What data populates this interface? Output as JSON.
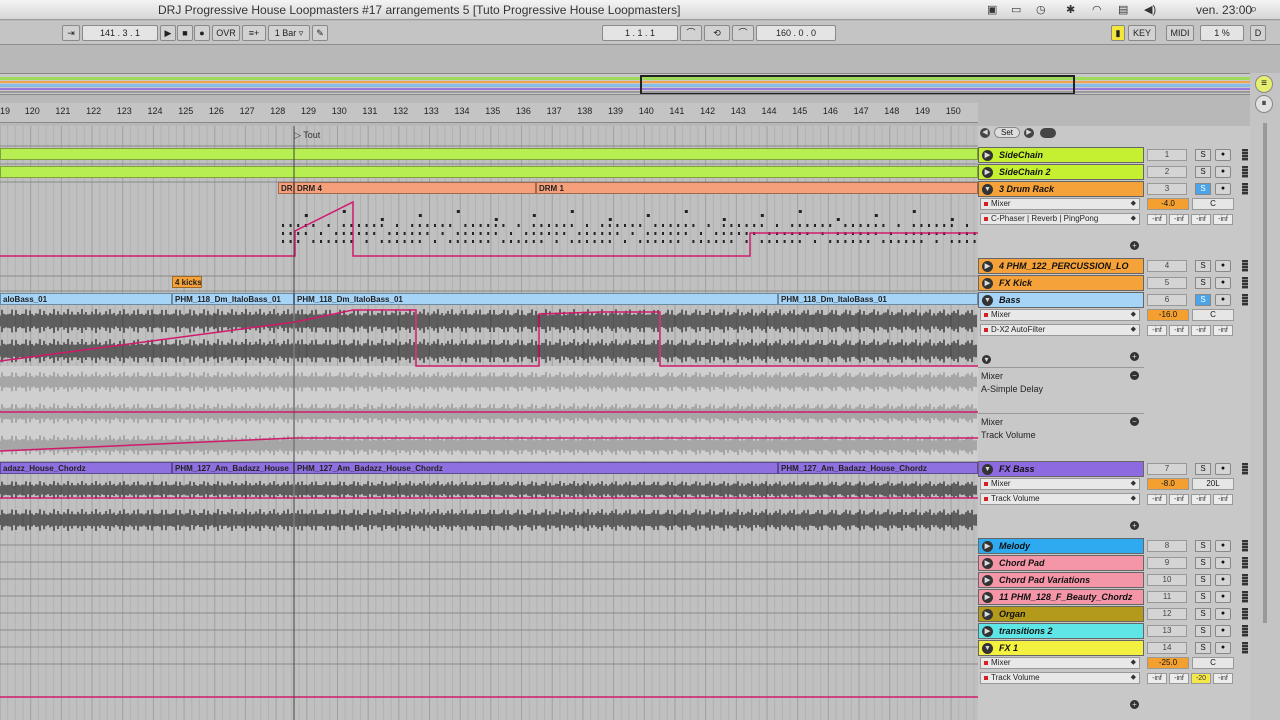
{
  "window_title": "DRJ Progressive House Loopmasters #17 arrangements 5  [Tuto Progressive House Loopmasters]",
  "menubar": {
    "clock": "ven. 23:00"
  },
  "transport": {
    "follow": "⇥",
    "position": "141 .  3 .  1",
    "play": "▶",
    "stop": "■",
    "record": "●",
    "ovr": "OVR",
    "quant": "≡+",
    "quant_value": "1 Bar ▿",
    "pencil": "✎",
    "loop_start": "1 .  1 .  1",
    "punch_in": "⌒",
    "loop": "⟲",
    "punch_out": "⌒",
    "loop_length": "160 .  0 .  0",
    "key_yellow": "▮",
    "key": "KEY",
    "midi": "MIDI",
    "cpu": "1 %",
    "d": "D"
  },
  "ruler": {
    "bars": [
      "19",
      "120",
      "121",
      "122",
      "123",
      "124",
      "125",
      "126",
      "127",
      "128",
      "129",
      "130",
      "131",
      "132",
      "133",
      "134",
      "135",
      "136",
      "137",
      "138",
      "139",
      "140",
      "141",
      "142",
      "143",
      "144",
      "145",
      "146",
      "147",
      "148",
      "149",
      "150"
    ]
  },
  "locator": "▷ Tout",
  "scene_set_label": "Set",
  "clips": {
    "drm4a": "DR",
    "drm4": "DRM 4",
    "drm1": "DRM 1",
    "kicks": "4 kicks",
    "bass1": "aloBass_01",
    "bass2": "PHM_118_Dm_ItaloBass_01",
    "bass3": "PHM_118_Dm_ItaloBass_01",
    "bass4": "PHM_118_Dm_ItaloBass_01",
    "chord1": "adazz_House_Chordz",
    "chord2": "PHM_127_Am_Badazz_House",
    "chord3": "PHM_127_Am_Badazz_House_Chordz",
    "chord4": "PHM_127_Am_Badazz_House_Chordz"
  },
  "tracks": [
    {
      "name": "SideChain",
      "num": "1",
      "color": "#c5f032",
      "solo": "S"
    },
    {
      "name": "SideChain 2",
      "num": "2",
      "color": "#c5f032",
      "solo": "S"
    },
    {
      "name": "3 Drum Rack",
      "num": "3",
      "color": "#f6a23a",
      "solo": "S"
    },
    {
      "name": "4 PHM_122_PERCUSSION_LO",
      "num": "4",
      "color": "#f6a23a",
      "solo": "S"
    },
    {
      "name": "FX Kick",
      "num": "5",
      "color": "#f6a23a",
      "solo": "S"
    },
    {
      "name": "Bass",
      "num": "6",
      "color": "#a6d4f7",
      "solo": "S"
    },
    {
      "name": "FX Bass",
      "num": "7",
      "color": "#8d6ae0",
      "solo": "S"
    },
    {
      "name": "Melody",
      "num": "8",
      "color": "#2eaaf0",
      "solo": "S"
    },
    {
      "name": "Chord Pad",
      "num": "9",
      "color": "#f596a8",
      "solo": "S"
    },
    {
      "name": "Chord Pad Variations",
      "num": "10",
      "color": "#f596a8",
      "solo": "S"
    },
    {
      "name": "11 PHM_128_F_Beauty_Chordz",
      "num": "11",
      "color": "#f596a8",
      "solo": "S"
    },
    {
      "name": "Organ",
      "num": "12",
      "color": "#b49a1a",
      "solo": "S"
    },
    {
      "name": "transitions 2",
      "num": "13",
      "color": "#5ee6e6",
      "solo": "S"
    },
    {
      "name": "FX 1",
      "num": "14",
      "color": "#f3f040",
      "solo": "S"
    }
  ],
  "drum": {
    "dev1": "Mixer",
    "dev2": "C-Phaser | Reverb | PingPong",
    "vol": "-4.0",
    "pan": "C",
    "inf": "-inf"
  },
  "bass": {
    "dev1": "Mixer",
    "dev2": "D-X2 AutoFilter",
    "vol": "-16.0",
    "pan": "C",
    "lane1a": "Mixer",
    "lane1b": "A-Simple Delay",
    "lane2a": "Mixer",
    "lane2b": "Track Volume",
    "inf": "-inf"
  },
  "fxbass": {
    "dev1": "Mixer",
    "dev2": "Track Volume",
    "vol": "-8.0",
    "pan": "20L",
    "inf": "-inf"
  },
  "fx1": {
    "dev1": "Mixer",
    "dev2": "Track Volume",
    "vol": "-25.0",
    "pan": "C",
    "inf": "-inf",
    "inf20": "-20"
  }
}
